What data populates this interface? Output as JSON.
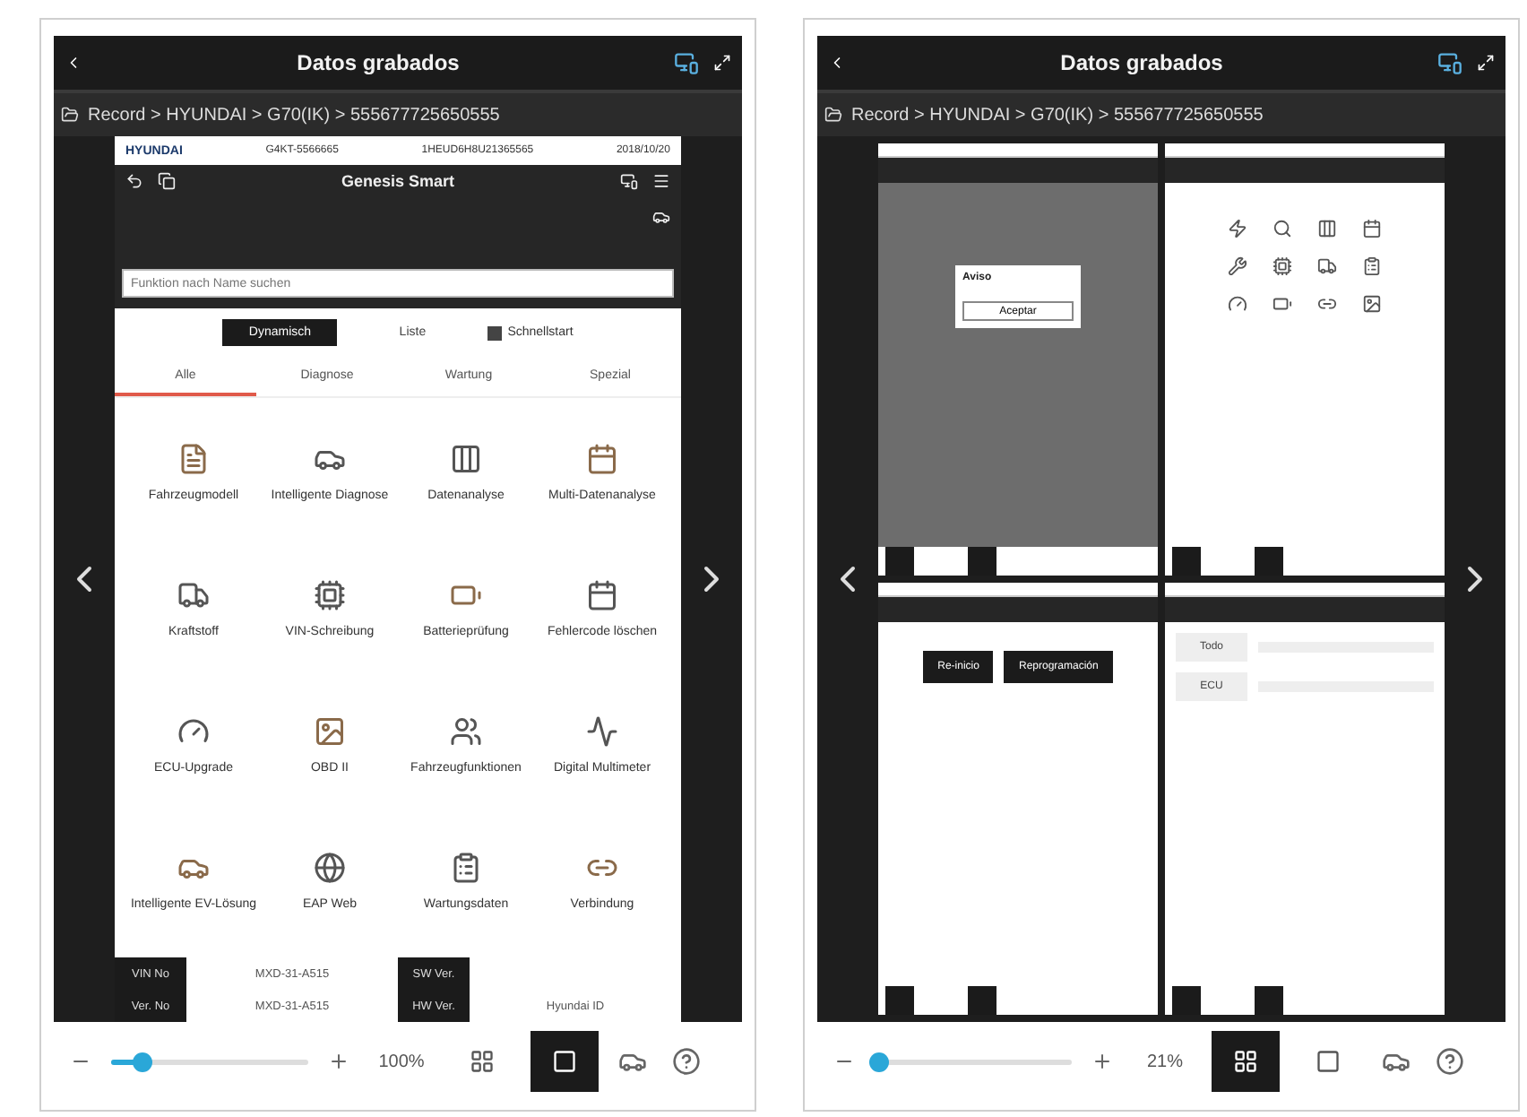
{
  "panels": [
    {
      "kind": "single",
      "title": "Datos grabados",
      "breadcrumb": "Record > HYUNDAI > G70(IK) > 555677725650555",
      "zoom": "100%",
      "level": 0.15,
      "view_buttons": [
        {
          "selected": false
        },
        {
          "selected": true
        }
      ],
      "screen": {
        "brand": "HYUNDAI",
        "header_info": [
          "G4KT-5566665",
          "1HEUD6H8U21365565",
          "2018/10/20"
        ],
        "app_title": "Genesis Smart",
        "search": {
          "placeholder": "Funktion nach Name suchen"
        },
        "segments": [
          {
            "label": "Dynamisch",
            "selected": true
          },
          {
            "label": "Liste",
            "selected": false
          }
        ],
        "quick_start": {
          "label": "Schnellstart",
          "checked": true
        },
        "tabs": [
          {
            "label": "Alle",
            "selected": true
          },
          {
            "label": "Diagnose",
            "selected": false
          },
          {
            "label": "Wartung",
            "selected": false
          },
          {
            "label": "Spezial",
            "selected": false
          }
        ],
        "functions": [
          "Fahrzeugmodell",
          "Intelligente Diagnose",
          "Datenanalyse",
          "Multi-Datenanalyse",
          "Kraftstoff",
          "VIN-Schreibung",
          "Batterieprüfung",
          "Fehlercode löschen",
          "ECU-Upgrade",
          "OBD II",
          "Fahrzeugfunktionen",
          "Digital Multimeter",
          "Intelligente EV-Lösung",
          "EAP Web",
          "Wartungsdaten",
          "Verbindung"
        ],
        "info": [
          {
            "label": "VIN No",
            "value": "MXD-31-A515"
          },
          {
            "label": "Ver. No",
            "value": "MXD-31-A515"
          },
          {
            "label": "SW Ver."
          },
          {
            "label": "HW Ver.",
            "value": "Hyundai ID"
          }
        ]
      }
    },
    {
      "kind": "grid",
      "title": "Datos grabados",
      "breadcrumb": "Record > HYUNDAI > G70(IK) > 555677725650555",
      "zoom": "21%",
      "level": 0.02,
      "view_buttons": [
        {
          "selected": true
        },
        {
          "selected": false
        }
      ],
      "thumbnails": [
        {
          "kind": "dialog",
          "title": "Aviso",
          "button": "Aceptar"
        },
        {
          "kind": "menu"
        },
        {
          "kind": "buttons",
          "labels": [
            "Re-inicio",
            "Reprogramación"
          ]
        },
        {
          "kind": "table",
          "rows": [
            "Todo",
            "ECU"
          ]
        }
      ]
    }
  ]
}
